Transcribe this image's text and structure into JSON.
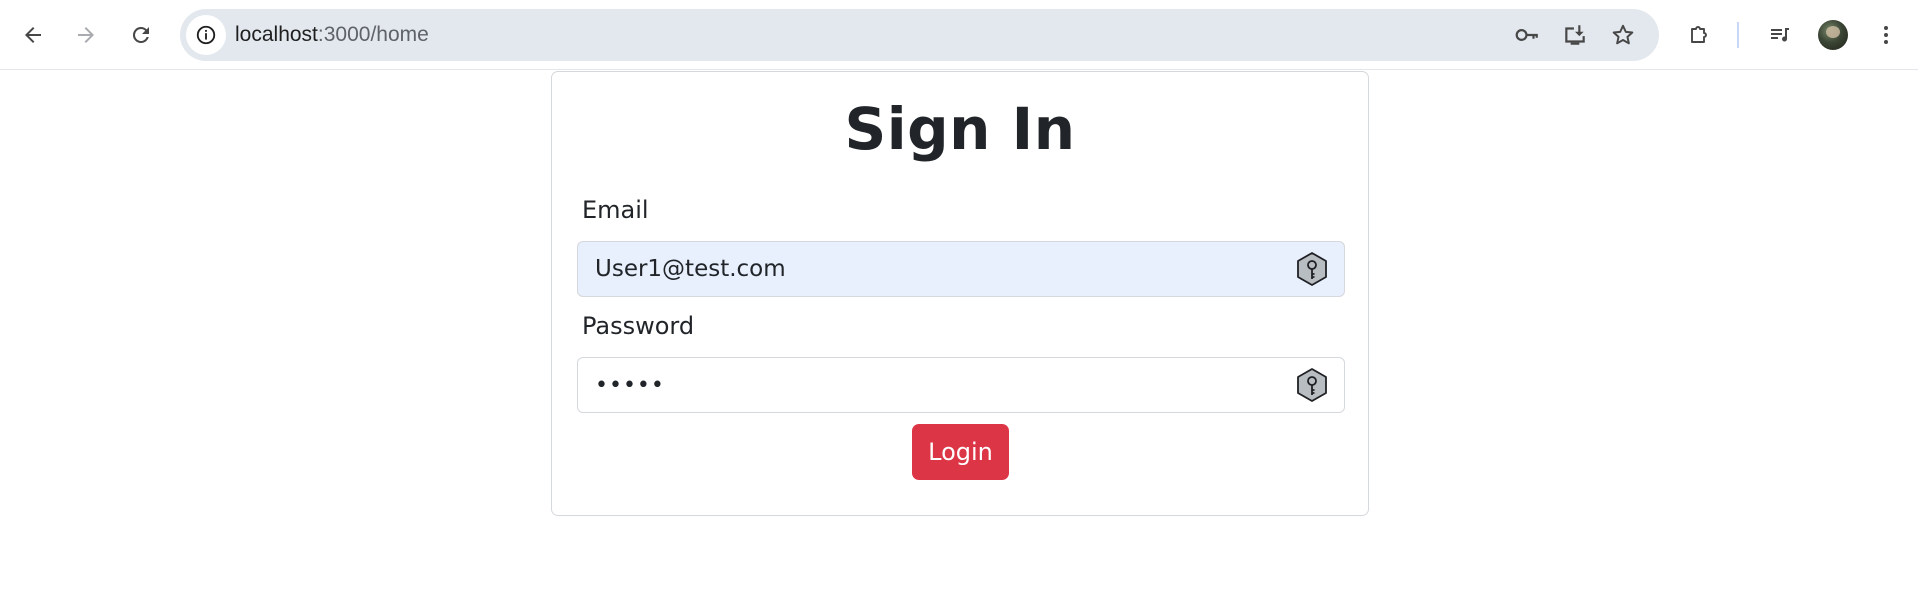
{
  "browser": {
    "url_host": "localhost",
    "url_path": ":3000/home",
    "icons": {
      "back": "arrow-left-icon",
      "forward": "arrow-right-icon",
      "reload": "reload-icon",
      "site_info": "info-icon",
      "password": "key-icon",
      "install": "install-app-icon",
      "bookmark": "star-icon",
      "extensions": "puzzle-icon",
      "media": "media-control-icon",
      "menu": "kebab-menu-icon"
    }
  },
  "form": {
    "title": "Sign In",
    "email_label": "Email",
    "email_value": "User1@test.com",
    "password_label": "Password",
    "password_value": "•••••",
    "login_label": "Login",
    "accent_color": "#dc3545",
    "autofill_color": "#e8f0fe"
  }
}
